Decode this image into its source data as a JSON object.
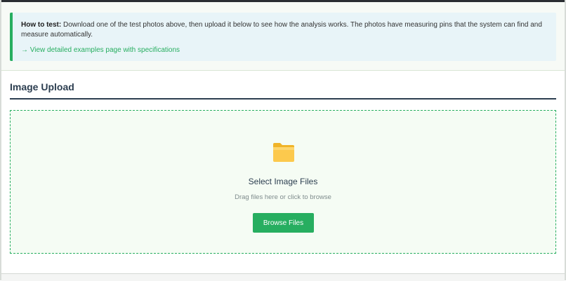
{
  "info": {
    "label": "How to test:",
    "text": " Download one of the test photos above, then upload it below to see how the analysis works. The photos have measuring pins that the system can find and measure automatically.",
    "link": "→ View detailed examples page with specifications"
  },
  "upload": {
    "title": "Image Upload",
    "icon": "folder-icon",
    "dropzone_title": "Select Image Files",
    "dropzone_subtitle": "Drag files here or click to browse",
    "browse_label": "Browse Files"
  },
  "colors": {
    "accent": "#27ae60",
    "info_background": "#e8f4f8",
    "dropzone_background": "#f5fcf4",
    "heading": "#2c3e50"
  }
}
